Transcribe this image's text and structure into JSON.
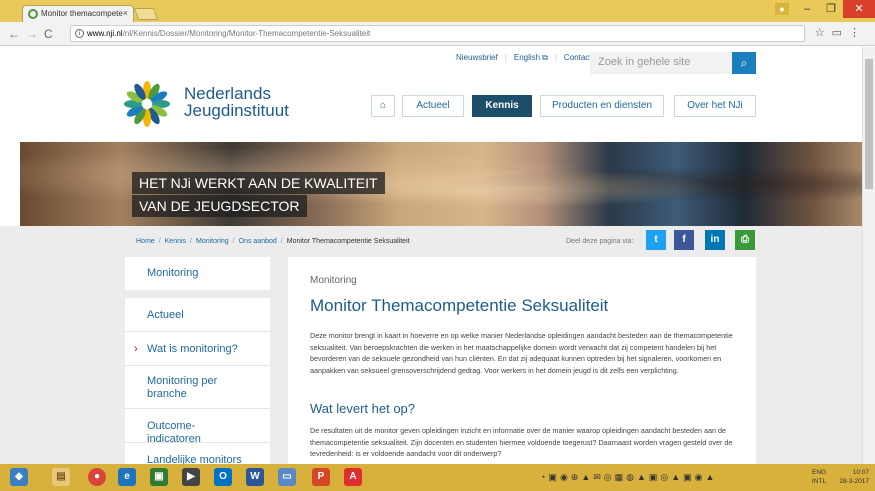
{
  "browser": {
    "tab_title": "Monitor themacompete",
    "tab_close": "×",
    "url_host": "www.nji.nl",
    "url_path": "/nl/Kennis/Dossier/Monitoring/Monitor-Themacompetentie-Seksualiteit"
  },
  "site": {
    "util_links": [
      "Nieuwsbrief",
      "English",
      "Contact"
    ],
    "search_placeholder": "Zoek in gehele site",
    "logo_line1": "Nederlands",
    "logo_line2": "Jeugdinstituut",
    "nav": [
      "Actueel",
      "Kennis",
      "Producten en diensten",
      "Over het NJi"
    ],
    "nav_active": "Kennis",
    "hero_line1": "HET NJi WERKT AAN DE KWALITEIT",
    "hero_line2": "VAN DE JEUGDSECTOR"
  },
  "breadcrumb": [
    "Home",
    "Kennis",
    "Monitoring",
    "Ons aanbod",
    "Monitor Themacompetentie Seksualiteit"
  ],
  "share": {
    "label": "Deel deze pagina via:",
    "buttons": [
      {
        "name": "twitter",
        "glyph": "t",
        "color": "#1da1f2"
      },
      {
        "name": "facebook",
        "glyph": "f",
        "color": "#3b5998"
      },
      {
        "name": "linkedin",
        "glyph": "in",
        "color": "#0077b5"
      },
      {
        "name": "print",
        "glyph": "⎙",
        "color": "#3a9a3a"
      }
    ]
  },
  "sidebar": {
    "heading": "Monitoring",
    "items": [
      "Actueel",
      "Wat is monitoring?",
      "Monitoring per branche",
      "Outcome-indicatoren",
      "Landelijke monitors"
    ],
    "active": "Wat is monitoring?"
  },
  "content": {
    "section": "Monitoring",
    "title": "Monitor Themacompetentie Seksualiteit",
    "paragraph": "Deze monitor brengt in kaart in hoeverre en op welke manier Nederlandse opleidingen aandacht besteden aan de themacompetentie seksualiteit. Van beroepskrachten die werken in het maatschappelijke domein wordt verwacht dat zij competent handelen bij het bevorderen van de seksuele gezondheid van hun cliënten. En dat zij adequaat kunnen optreden bij het signaleren, voorkomen en aanpakken van seksueel grensoverschrijdend gedrag. Voor werkers in het domein jeugd is dit zelfs een verplichting.",
    "subheading": "Wat levert het op?",
    "paragraph2": "De resultaten uit de monitor geven opleidingen inzicht en informatie over de manier waarop opleidingen aandacht besteden aan de themacompetentie seksualiteit. Zijn docenten en studenten hiermee voldoende toegerust? Daarnaast worden vragen gesteld over de tevredenheid: is er voldoende aandacht voor dit onderwerp?"
  },
  "taskbar": {
    "lang1": "ENG",
    "lang2": "INTL",
    "time": "10:07",
    "date": "28-3-2017"
  }
}
